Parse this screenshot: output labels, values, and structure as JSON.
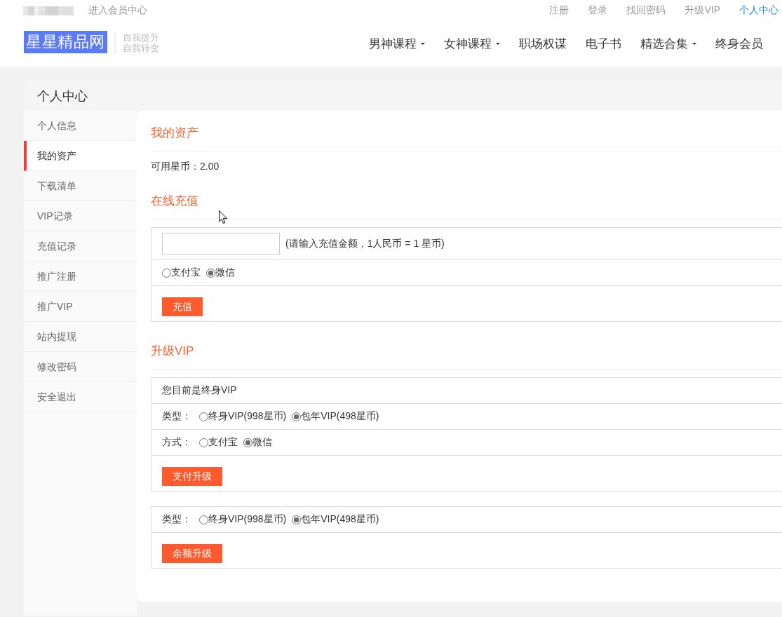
{
  "top_bar": {
    "member_center_link": "进入会员中心",
    "links": [
      {
        "label": "注册",
        "selected": false
      },
      {
        "label": "登录",
        "selected": false
      },
      {
        "label": "找回密码",
        "selected": false
      },
      {
        "label": "升级VIP",
        "selected": false
      },
      {
        "label": "个人中心",
        "selected": true
      }
    ]
  },
  "header": {
    "logo": "星星精品网",
    "slogan": [
      "自我提升",
      "自我转变"
    ],
    "nav": [
      {
        "label": "男神课程",
        "dropdown": true
      },
      {
        "label": "女神课程",
        "dropdown": true
      },
      {
        "label": "职场权谋",
        "dropdown": false
      },
      {
        "label": "电子书",
        "dropdown": false
      },
      {
        "label": "精选合集",
        "dropdown": true
      },
      {
        "label": "终身会员",
        "dropdown": false
      }
    ]
  },
  "sidebar": {
    "title": "个人中心",
    "items": [
      {
        "label": "个人信息",
        "selected": false
      },
      {
        "label": "我的资产",
        "selected": true
      },
      {
        "label": "下载清单",
        "selected": false
      },
      {
        "label": "VIP记录",
        "selected": false
      },
      {
        "label": "充值记录",
        "selected": false
      },
      {
        "label": "推广注册",
        "selected": false
      },
      {
        "label": "推广VIP",
        "selected": false
      },
      {
        "label": "站内提现",
        "selected": false
      },
      {
        "label": "修改密码",
        "selected": false
      },
      {
        "label": "安全退出",
        "selected": false
      }
    ]
  },
  "assets": {
    "heading": "我的资产",
    "balance": "可用星币：2.00"
  },
  "recharge": {
    "heading": "在线充值",
    "amount_hint": "(请输入充值金额，1人民币 = 1 星币)",
    "payment_options": [
      {
        "label": "支付宝",
        "selected": false
      },
      {
        "label": "微信",
        "selected": true
      }
    ],
    "button": "充值"
  },
  "upgrade_vip": {
    "heading": "升级VIP",
    "status": "您目前是终身VIP",
    "type": {
      "label": "类型：",
      "options": [
        {
          "label": "终身VIP(998星币)",
          "selected": false
        },
        {
          "label": "包年VIP(498星币)",
          "selected": true
        }
      ]
    },
    "method": {
      "label": "方式：",
      "options": [
        {
          "label": "支付宝",
          "selected": false
        },
        {
          "label": "微信",
          "selected": true
        }
      ]
    },
    "button": "支付升级"
  },
  "balance_upgrade": {
    "type": {
      "label": "类型：",
      "options": [
        {
          "label": "终身VIP(998星币)",
          "selected": false
        },
        {
          "label": "包年VIP(498星币)",
          "selected": true
        }
      ]
    },
    "button": "余额升级"
  }
}
